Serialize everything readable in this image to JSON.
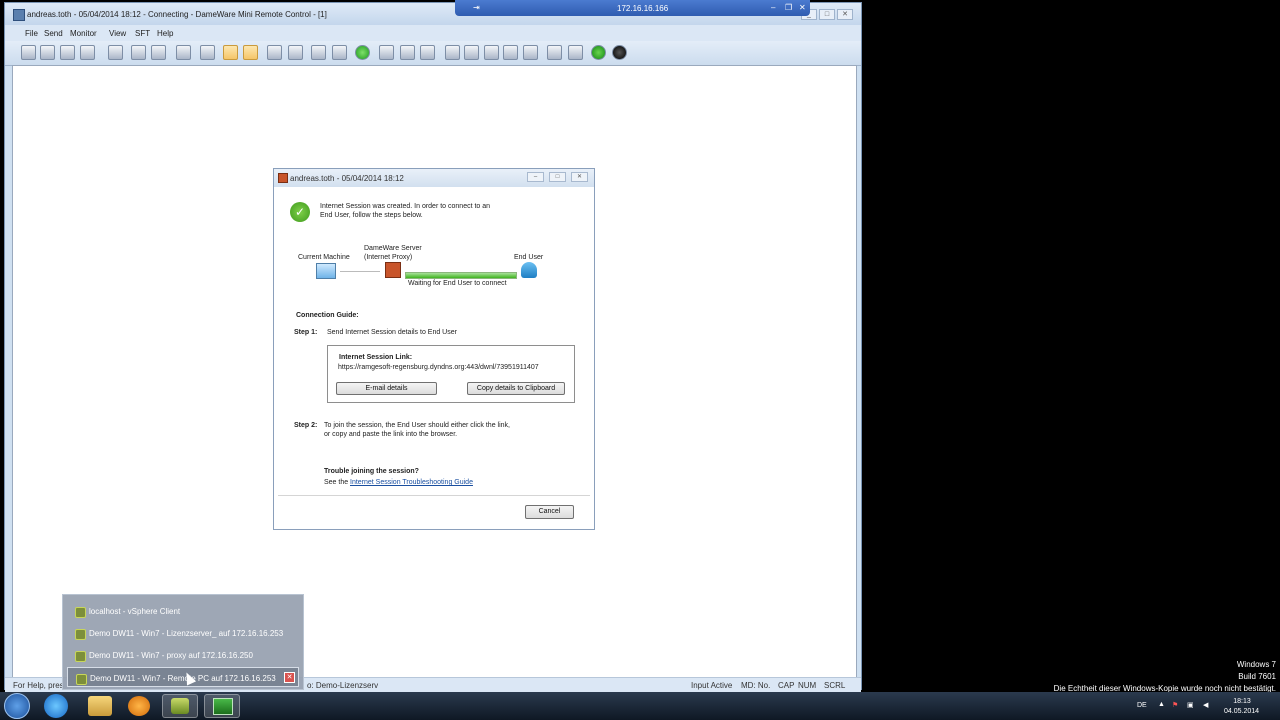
{
  "main_window": {
    "title": "andreas.toth - 05/04/2014 18:12 - Connecting - DameWare Mini Remote Control - [1]",
    "menu": [
      "File",
      "Send",
      "Monitor",
      "View",
      "SFT",
      "Help"
    ],
    "status": {
      "help": "For Help, pres",
      "remote": "o: Demo-Lizenzserv",
      "input": "Input Active",
      "md": "MD: No.",
      "cap": "CAP",
      "num": "NUM",
      "scrl": "SCRL"
    }
  },
  "connection_bar": {
    "address": "172.16.16.166"
  },
  "dialog": {
    "title": "andreas.toth - 05/04/2014 18:12",
    "message_line1": "Internet Session was created. In order to connect to an",
    "message_line2": "End User, follow the steps below.",
    "current_machine": "Current Machine",
    "server_line1": "DameWare Server",
    "server_line2": "(Internet Proxy)",
    "end_user": "End User",
    "waiting": "Waiting for End User to connect",
    "guide_title": "Connection Guide:",
    "step1_label": "Step 1:",
    "step1_text": "Send Internet Session details to End User",
    "link_title": "Internet Session Link:",
    "link_url": "https://ramgesoft-regensburg.dyndns.org:443/dwnl/73951911407",
    "email_button": "E-mail details",
    "copy_button": "Copy details to Clipboard",
    "step2_label": "Step 2:",
    "step2_line1": "To join the session, the End User should either click the link,",
    "step2_line2": "or copy and paste the link into the browser.",
    "trouble_title": "Trouble joining the session?",
    "trouble_prefix": "See the",
    "trouble_link": "Internet Session Troubleshooting Guide",
    "cancel_button": "Cancel"
  },
  "jumplist": {
    "items": [
      "localhost - vSphere Client",
      "Demo DW11 - Win7 - Lizenzserver_ auf 172.16.16.253",
      "Demo DW11 - Win7 - proxy auf 172.16.16.250",
      "Demo DW11 - Win7 - Remote PC auf 172.16.16.253"
    ]
  },
  "taskbar": {
    "lang": "DE",
    "time": "18:13",
    "date": "04.05.2014"
  },
  "watermark": {
    "line1": "Windows 7",
    "line2": "Build 7601",
    "line3": "Die Echtheit dieser Windows-Kopie wurde noch nicht bestätigt."
  },
  "colors": {
    "title_bar": "#cfe0f1",
    "connection_bar": "#2f5cb0",
    "progress": "#3fb31f"
  }
}
